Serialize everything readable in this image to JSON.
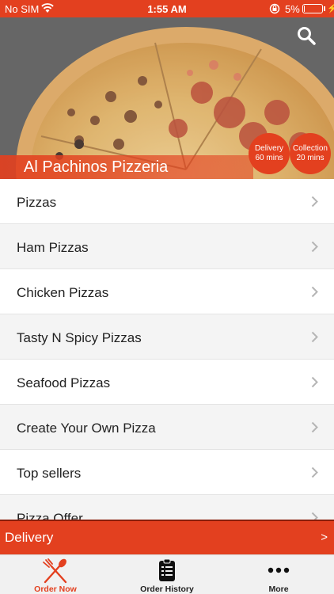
{
  "status": {
    "carrier": "No SIM",
    "time": "1:55 AM",
    "battery_pct": "5%",
    "battery_level": 0.05
  },
  "hero": {
    "title": "Al Pachinos Pizzeria",
    "delivery_badge": {
      "line1": "Delivery",
      "line2": "60 mins"
    },
    "collection_badge": {
      "line1": "Collection",
      "line2": "20 mins"
    },
    "search_icon": "search-icon"
  },
  "menu": {
    "items": [
      {
        "label": "Pizzas"
      },
      {
        "label": "Ham Pizzas"
      },
      {
        "label": "Chicken Pizzas"
      },
      {
        "label": "Tasty N Spicy Pizzas"
      },
      {
        "label": "Seafood Pizzas"
      },
      {
        "label": "Create Your Own Pizza"
      },
      {
        "label": "Top sellers"
      },
      {
        "label": "Pizza Offer"
      }
    ]
  },
  "delivery_bar": {
    "label": "Delivery",
    "arrow": ">"
  },
  "tabs": [
    {
      "label": "Order Now",
      "icon": "fork-knife-icon",
      "active": true
    },
    {
      "label": "Order History",
      "icon": "clipboard-list-icon",
      "active": false
    },
    {
      "label": "More",
      "icon": "more-dots-icon",
      "active": false
    }
  ],
  "colors": {
    "accent": "#e3401f",
    "tab_bar_bg": "#f1f1f1"
  }
}
